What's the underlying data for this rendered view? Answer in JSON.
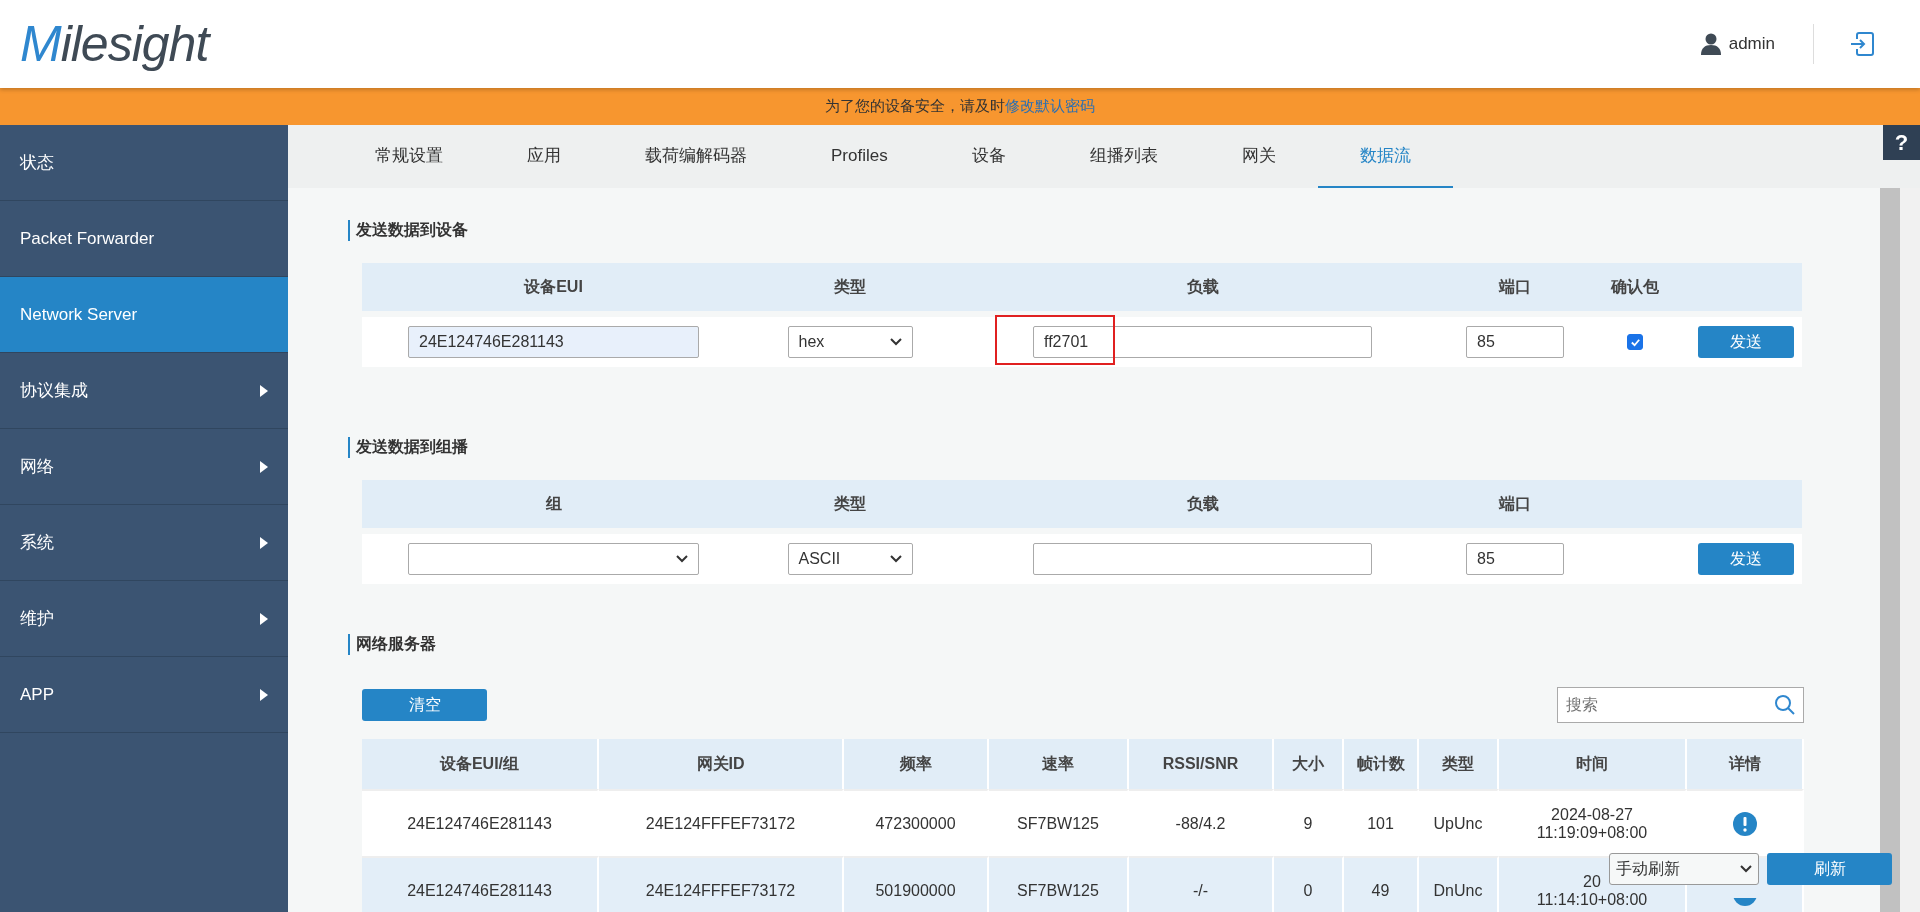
{
  "header": {
    "logo": "Milesight",
    "user": "admin"
  },
  "notice": {
    "text": "为了您的设备安全，请及时",
    "link": "修改默认密码"
  },
  "sidebar": {
    "items": [
      {
        "label": "状态",
        "selected": false,
        "submenu": false
      },
      {
        "label": "Packet Forwarder",
        "selected": false,
        "submenu": false
      },
      {
        "label": "Network Server",
        "selected": true,
        "submenu": false
      },
      {
        "label": "协议集成",
        "selected": false,
        "submenu": true
      },
      {
        "label": "网络",
        "selected": false,
        "submenu": true
      },
      {
        "label": "系统",
        "selected": false,
        "submenu": true
      },
      {
        "label": "维护",
        "selected": false,
        "submenu": true
      },
      {
        "label": "APP",
        "selected": false,
        "submenu": true
      }
    ]
  },
  "help": "?",
  "tabs": [
    {
      "label": "常规设置",
      "selected": false
    },
    {
      "label": "应用",
      "selected": false
    },
    {
      "label": "载荷编解码器",
      "selected": false
    },
    {
      "label": "Profiles",
      "selected": false
    },
    {
      "label": "设备",
      "selected": false
    },
    {
      "label": "组播列表",
      "selected": false
    },
    {
      "label": "网关",
      "selected": false
    },
    {
      "label": "数据流",
      "selected": true
    }
  ],
  "send_device": {
    "title": "发送数据到设备",
    "columns": [
      "设备EUI",
      "类型",
      "负载",
      "端口",
      "确认包"
    ],
    "eui": "24E124746E281143",
    "type": "hex",
    "payload": "ff2701",
    "payload_highlighted": true,
    "port": "85",
    "confirmed": true,
    "button": "发送"
  },
  "send_group": {
    "title": "发送数据到组播",
    "columns": [
      "组",
      "类型",
      "负载",
      "端口"
    ],
    "type": "ASCII",
    "port": "85",
    "button": "发送"
  },
  "network_server": {
    "title": "网络服务器",
    "clear_button": "清空",
    "search": {
      "placeholder": "搜索"
    },
    "columns": [
      "设备EUI/组",
      "网关ID",
      "频率",
      "速率",
      "RSSI/SNR",
      "大小",
      "帧计数",
      "类型",
      "时间",
      "详情"
    ],
    "rows": [
      {
        "cells": [
          "24E124746E281143",
          "24E124FFFEF73172",
          "472300000",
          "SF7BW125",
          "-88/4.2",
          "9",
          "101",
          "UpUnc"
        ],
        "time": [
          "2024-08-27",
          "11:19:09+08:00"
        ]
      },
      {
        "cells": [
          "24E124746E281143",
          "24E124FFFEF73172",
          "501900000",
          "SF7BW125",
          "-/-",
          "0",
          "49",
          "DnUnc"
        ],
        "time": [
          "20",
          "11:14:10+08:00"
        ]
      }
    ]
  },
  "refresh": {
    "mode": "手动刷新",
    "button": "刷新"
  }
}
